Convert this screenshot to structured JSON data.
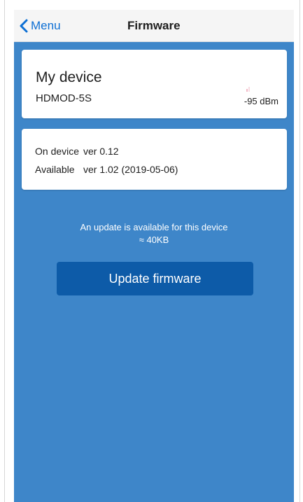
{
  "nav": {
    "back_label": "Menu",
    "title": "Firmware"
  },
  "device": {
    "name": "My device",
    "model": "HDMOD-5S",
    "signal": "-95 dBm",
    "signal_icon": "signal-strength-icon"
  },
  "versions": {
    "on_device_label": "On device",
    "on_device_value": "ver 0.12",
    "available_label": "Available",
    "available_value": "ver 1.02 (2019-05-06)"
  },
  "update": {
    "message": "An update is available for this device",
    "size": "≈ 40KB",
    "button_label": "Update firmware"
  },
  "colors": {
    "background": "#3e86c9",
    "accent": "#0d6fd4",
    "button": "#0d5ba8",
    "card": "#ffffff"
  }
}
